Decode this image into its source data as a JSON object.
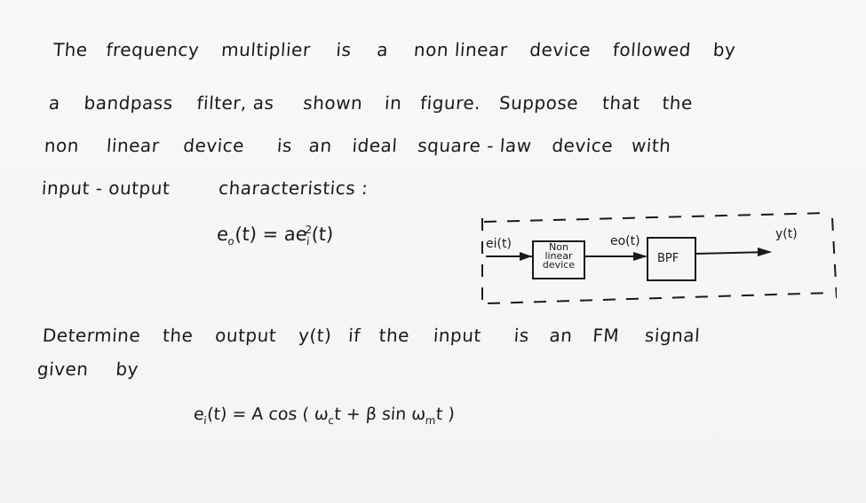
{
  "problem": {
    "paragraph1": {
      "line1": {
        "w1": "The",
        "w2": "frequency",
        "w3": "multiplier",
        "w4": "is",
        "w5": "a",
        "w6": "non linear",
        "w7": "device",
        "w8": "followed",
        "w9": "by"
      },
      "line2": {
        "w1": "a",
        "w2": "bandpass",
        "w3": "filter, as",
        "w4": "shown",
        "w5": "in",
        "w6": "figure.",
        "w7": "Suppose",
        "w8": "that",
        "w9": "the"
      },
      "line3": {
        "w1": "non",
        "w2": "linear",
        "w3": "device",
        "w4": "is",
        "w5": "an",
        "w6": "ideal",
        "w7": "square - law",
        "w8": "device",
        "w9": "with"
      },
      "line4": {
        "w1": "input - output",
        "w2": "characteristics :"
      }
    },
    "characteristic_equation": {
      "lhs": "e",
      "lhs_sub": "o",
      "lhs_arg": "(t) = ae",
      "rhs_sub": "i",
      "rhs_sup": "2",
      "rhs_arg": "(t)"
    },
    "paragraph2": {
      "line1": {
        "w1": "Determine",
        "w2": "the",
        "w3": "output",
        "w4": "y(t)",
        "w5": "if",
        "w6": "the",
        "w7": "input",
        "w8": "is",
        "w9": "an",
        "w10": "FM",
        "w11": "signal"
      },
      "line2": {
        "w1": "given",
        "w2": "by"
      }
    },
    "input_equation": {
      "lhs": "e",
      "lhs_sub": "i",
      "p1": "(t) = A cos ( ω",
      "sub_c": "c",
      "p2": "t + β sin ω",
      "sub_m": "m",
      "p3": "t )"
    }
  },
  "diagram": {
    "input_label": "ei(t)",
    "nonlinear_box": {
      "line1": "Non",
      "line2": "linear",
      "line3": "device"
    },
    "middle_label": "eo(t)",
    "bpf_box": "BPF",
    "output_label": "y(t)"
  }
}
